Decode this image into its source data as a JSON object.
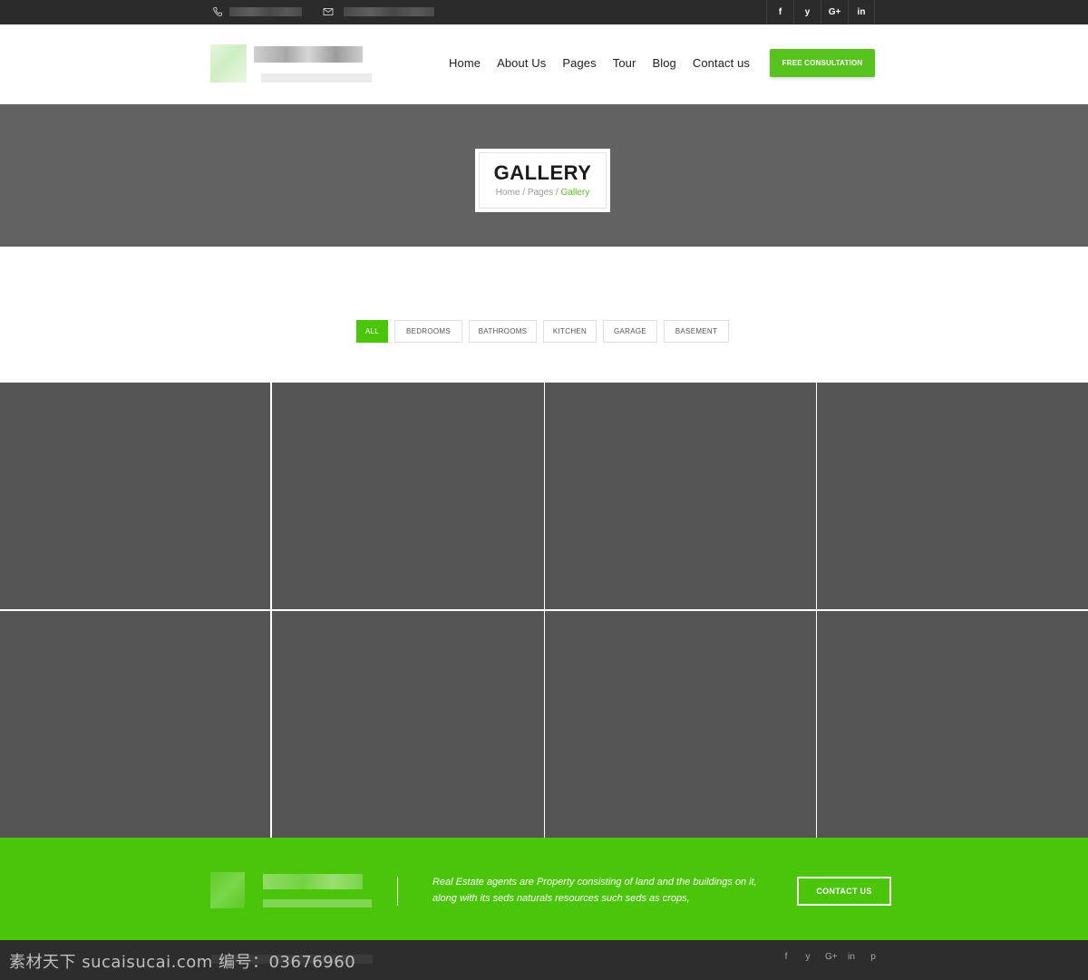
{
  "topbar": {
    "phone_icon": "phone-icon",
    "mail_icon": "envelope-icon",
    "social": [
      {
        "icon": "facebook-icon",
        "glyph": "f"
      },
      {
        "icon": "twitter-icon",
        "glyph": "y"
      },
      {
        "icon": "google-plus-icon",
        "glyph": "G+"
      },
      {
        "icon": "linkedin-icon",
        "glyph": "in"
      }
    ]
  },
  "nav": {
    "items": [
      "Home",
      "About Us",
      "Pages",
      "Tour",
      "Blog",
      "Contact us"
    ],
    "cta": "FREE CONSULTATION"
  },
  "banner": {
    "title": "GALLERY",
    "breadcrumb": {
      "home": "Home",
      "pages": "Pages",
      "current": "Gallery"
    }
  },
  "filters": [
    "ALL",
    "BEDROOMS",
    "BATHROOMS",
    "KITCHEN",
    "GARAGE",
    "BASEMENT"
  ],
  "footer": {
    "text": "Real Estate agents are Property consisting of land and the buildings on it, along with its seds naturals resources such seds as crops,",
    "button": "CONTACT US",
    "watermark": "素材天下 sucaisucai.com  编号：03676960",
    "social": [
      {
        "icon": "facebook-icon",
        "glyph": "f"
      },
      {
        "icon": "twitter-icon",
        "glyph": "y"
      },
      {
        "icon": "google-plus-icon",
        "glyph": "G+"
      },
      {
        "icon": "linkedin-icon",
        "glyph": "in"
      },
      {
        "icon": "pinterest-icon",
        "glyph": "p"
      }
    ]
  },
  "colors": {
    "accent": "#4bc50a",
    "dark": "#2b2b2b",
    "banner": "#626262",
    "tile": "#555555"
  }
}
